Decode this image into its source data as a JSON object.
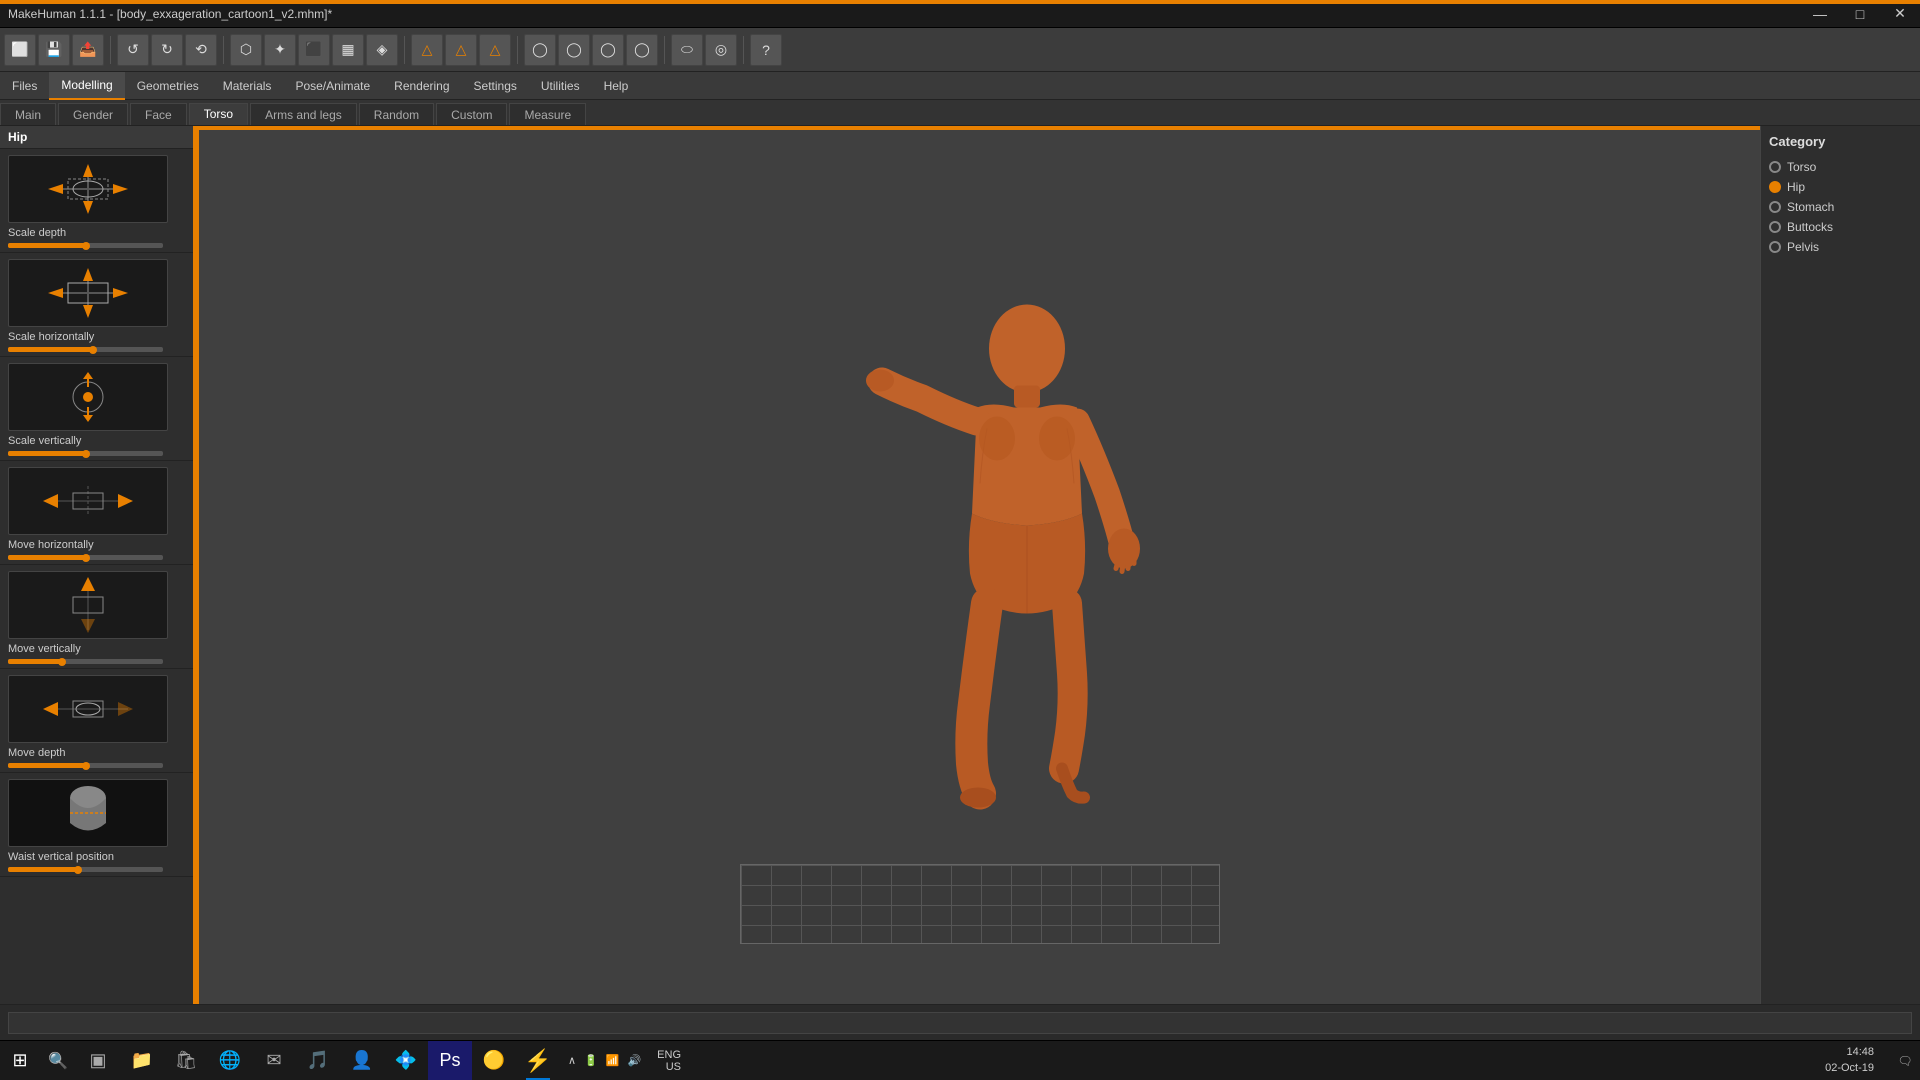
{
  "titlebar": {
    "title": "MakeHuman 1.1.1 - [body_exxageration_cartoon1_v2.mhm]*",
    "minimize": "—",
    "maximize": "□",
    "close": "✕"
  },
  "toolbar": {
    "buttons": [
      "□",
      "💾",
      "↺",
      "↺",
      "↻",
      "⟲",
      "⬡",
      "✦",
      "⬛",
      "▦",
      "◈",
      "△",
      "△",
      "△",
      "◯",
      "◯",
      "◯",
      "◯",
      "⬭",
      "◎",
      "?"
    ]
  },
  "menubar": {
    "items": [
      "Files",
      "Modelling",
      "Geometries",
      "Materials",
      "Pose/Animate",
      "Rendering",
      "Settings",
      "Utilities",
      "Help"
    ]
  },
  "tabs": {
    "items": [
      "Main",
      "Gender",
      "Face",
      "Torso",
      "Arms and legs",
      "Random",
      "Custom",
      "Measure"
    ]
  },
  "left_panel": {
    "section": "Hip",
    "modifiers": [
      {
        "id": "scale-depth",
        "label": "Scale depth",
        "value": 50
      },
      {
        "id": "scale-horizontally",
        "label": "Scale horizontally",
        "value": 55
      },
      {
        "id": "scale-vertically",
        "label": "Scale vertically",
        "value": 50
      },
      {
        "id": "move-horizontally",
        "label": "Move horizontally",
        "value": 50
      },
      {
        "id": "move-vertically",
        "label": "Move vertically",
        "value": 35
      },
      {
        "id": "move-depth",
        "label": "Move depth",
        "value": 50
      },
      {
        "id": "waist-vertical",
        "label": "Waist vertical position",
        "value": 45
      }
    ]
  },
  "right_panel": {
    "category_label": "Category",
    "items": [
      {
        "id": "torso",
        "label": "Torso",
        "selected": false
      },
      {
        "id": "hip",
        "label": "Hip",
        "selected": true
      },
      {
        "id": "stomach",
        "label": "Stomach",
        "selected": false
      },
      {
        "id": "buttocks",
        "label": "Buttocks",
        "selected": false
      },
      {
        "id": "pelvis",
        "label": "Pelvis",
        "selected": false
      }
    ]
  },
  "statusbar": {
    "placeholder": ""
  },
  "taskbar": {
    "time": "14:48",
    "date": "02-Oct-19",
    "lang": "ENG",
    "region": "US",
    "items": [
      "⊞",
      "🔍",
      "▣",
      "📁",
      "🛍",
      "🌐",
      "✉",
      "🎵",
      "👤",
      "💠",
      "Ps",
      "🟡",
      "⚡"
    ]
  }
}
